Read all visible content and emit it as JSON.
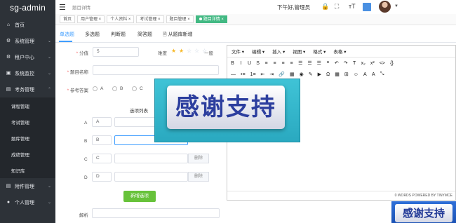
{
  "app": {
    "logo": "sg-admin"
  },
  "sidebar": {
    "items": [
      {
        "label": "首页",
        "icon": "home-icon",
        "glyph": "⌂"
      },
      {
        "label": "系统管理",
        "icon": "gear-icon",
        "glyph": "⚙",
        "chevron": "⌄"
      },
      {
        "label": "租户中心",
        "icon": "tenant-icon",
        "glyph": "⚙",
        "chevron": "⌄"
      },
      {
        "label": "系统监控",
        "icon": "monitor-icon",
        "glyph": "▣",
        "chevron": "⌄"
      },
      {
        "label": "考务管理",
        "icon": "exam-icon",
        "glyph": "▤",
        "chevron": "⌃"
      }
    ],
    "sub_items": [
      "课程管理",
      "考试管理",
      "题库管理",
      "成绩管理",
      "知识库"
    ],
    "bottom_items": [
      {
        "label": "附件管理",
        "icon": "attachment-icon",
        "glyph": "▤",
        "chevron": "⌄"
      },
      {
        "label": "个人管理",
        "icon": "user-icon",
        "glyph": "●",
        "chevron": "⌄"
      }
    ]
  },
  "header": {
    "breadcrumb": "题目详情",
    "greeting": "下午好,管理员",
    "icons": [
      "lock-icon",
      "fullscreen-icon",
      "font-size-icon",
      "theme-icon",
      "avatar",
      "caret-down-icon"
    ]
  },
  "tabs": [
    {
      "label": "首页",
      "active": false
    },
    {
      "label": "用户管理 ×",
      "active": false
    },
    {
      "label": "个人资料 ×",
      "active": false
    },
    {
      "label": "考试管理 ×",
      "active": false
    },
    {
      "label": "题目管理 ×",
      "active": false
    },
    {
      "label": "题目详情 ×",
      "active": true
    }
  ],
  "question_types": {
    "single": "单选题",
    "multi": "多选题",
    "judge": "判断题",
    "short": "简答题",
    "from_bank": "从题库新增",
    "active": "单选题"
  },
  "form": {
    "score_label": "分值",
    "score_value": "5",
    "difficulty_label": "难度",
    "difficulty_stars": 2,
    "difficulty_max": 5,
    "difficulty_text": "一般",
    "name_label": "题目名称",
    "answer_label": "参考答案",
    "answer_options": [
      "A",
      "B",
      "C"
    ],
    "options_title": "选项列表",
    "options": [
      {
        "letter": "A",
        "value": "A"
      },
      {
        "letter": "B",
        "value": "B"
      },
      {
        "letter": "C",
        "value": "C"
      },
      {
        "letter": "D",
        "value": "D"
      }
    ],
    "delete_label": "删除",
    "add_option_label": "新增选项",
    "analysis_label": "解析"
  },
  "editor": {
    "menu": [
      "文件 ▾",
      "编辑 ▾",
      "插入 ▾",
      "视图 ▾",
      "格式 ▾",
      "表格 ▾"
    ],
    "toolbar_row1": [
      "B",
      "I",
      "U",
      "S",
      "≡",
      "≡",
      "≡",
      "≡",
      "☰",
      "☰",
      "☰",
      "❝",
      "↶",
      "↷",
      "T",
      "x₂",
      "x²",
      "<>",
      "{}"
    ],
    "toolbar_row2": [
      "—",
      "•≡",
      "1≡",
      "⇤",
      "⇥",
      "🔗",
      "▦",
      "◉",
      "✎",
      "▶",
      "Ω",
      "▦",
      "⊞",
      "☺",
      "A",
      "A",
      "⤡"
    ],
    "status": "0 WORDS POWERED BY TINYMCE"
  },
  "overlay": {
    "big_text": "感谢支持",
    "small_text": "感谢支持"
  },
  "colors": {
    "sidebar": "#2d3238",
    "primary": "#409eff",
    "success": "#67c23a",
    "active_tab": "#42b983"
  }
}
